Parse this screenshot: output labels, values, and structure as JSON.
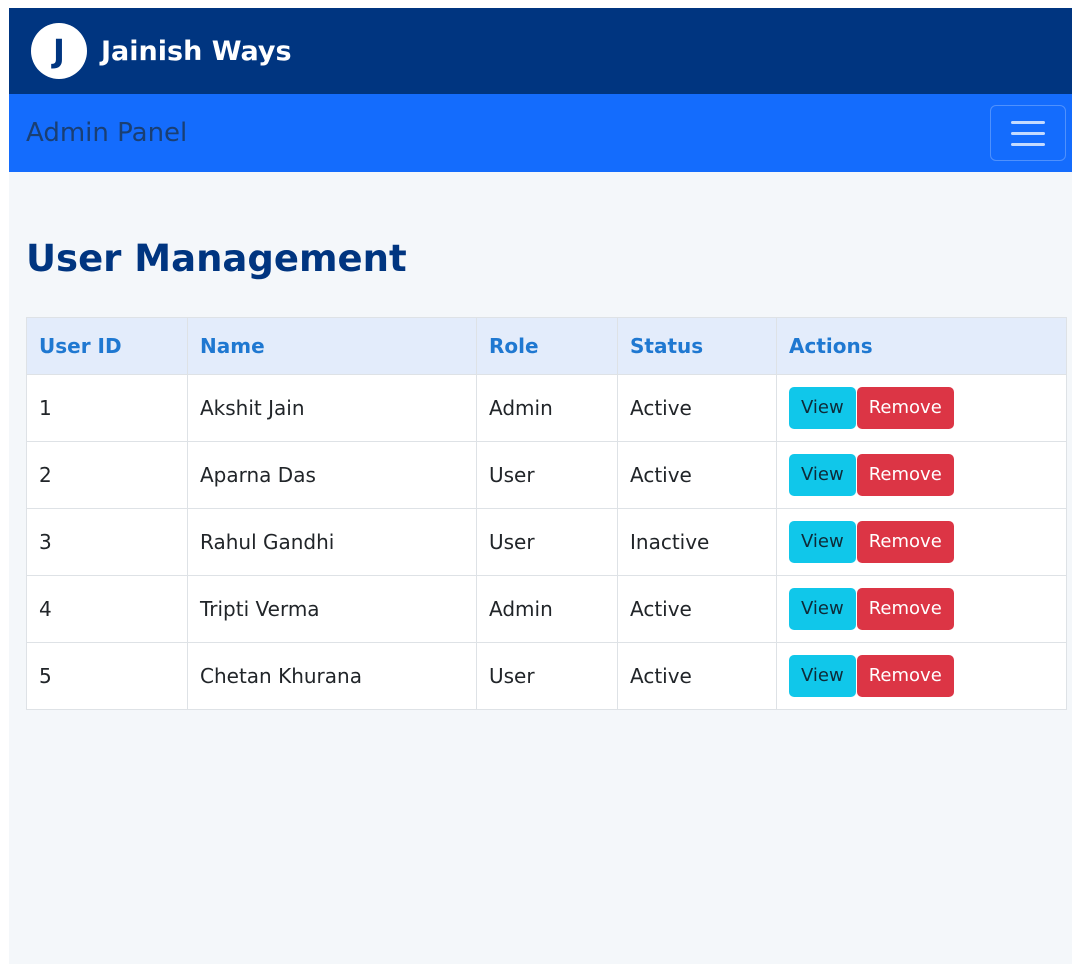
{
  "brand": {
    "logo_letter": "J",
    "name": "Jainish Ways"
  },
  "navbar": {
    "title": "Admin Panel"
  },
  "page": {
    "title": "User Management"
  },
  "table": {
    "headers": [
      "User ID",
      "Name",
      "Role",
      "Status",
      "Actions"
    ],
    "rows": [
      {
        "id": "1",
        "name": "Akshit Jain",
        "role": "Admin",
        "status": "Active"
      },
      {
        "id": "2",
        "name": "Aparna Das",
        "role": "User",
        "status": "Active"
      },
      {
        "id": "3",
        "name": "Rahul Gandhi",
        "role": "User",
        "status": "Inactive"
      },
      {
        "id": "4",
        "name": "Tripti Verma",
        "role": "Admin",
        "status": "Active"
      },
      {
        "id": "5",
        "name": "Chetan Khurana",
        "role": "User",
        "status": "Active"
      }
    ],
    "view_label": "View",
    "remove_label": "Remove"
  },
  "colors": {
    "brandbar": "#003580",
    "navbar": "#146cfd",
    "page_background": "#f4f7fa",
    "header_row": "#e3ecfb",
    "view_button": "#10c7ea",
    "remove_button": "#dc3545"
  },
  "icons": {
    "menu": "hamburger-menu-icon"
  }
}
